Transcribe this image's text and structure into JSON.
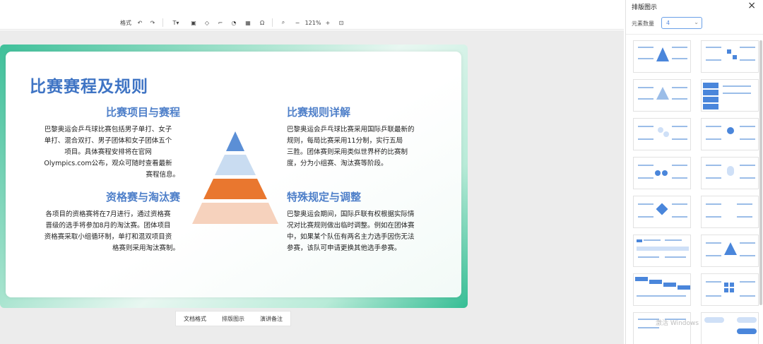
{
  "toolbar": {
    "format_label": "格式",
    "zoom_value": "121%"
  },
  "slide": {
    "title": "比赛赛程及规则",
    "sections": {
      "schedule": {
        "heading": "比赛项目与赛程",
        "lines": [
          "巴黎奥运会乒乓球比赛包括男子单打、女子",
          "单打、混合双打、男子团体和女子团体五个",
          "项目。具体赛程安排将在官网",
          "Olympics.com公布，观众可随时查看最新",
          "赛程信息。"
        ]
      },
      "rules": {
        "heading": "比赛规则详解",
        "lines": [
          "巴黎奥运会乒乓球比赛采用国际乒联最新的",
          "规则，每局比赛采用11分制，实行五局",
          "三胜。团体赛则采用类似世界杯的比赛制",
          "度，分为小组赛、淘汰赛等阶段。"
        ]
      },
      "qualify": {
        "heading": "资格赛与淘汰赛",
        "lines": [
          "各项目的资格赛将在7月进行，通过资格赛",
          "晋级的选手将参加8月的淘汰赛。团体项目",
          "资格赛采取小组循环制，单打和混双项目资",
          "格赛则采用淘汰赛制。"
        ]
      },
      "special": {
        "heading": "特殊规定与调整",
        "lines": [
          "巴黎奥运会期间，国际乒联有权根据实际情",
          "况对比赛规则做出临时调整。例如在团体赛",
          "中，如果某个队伍有两名主力选手因伤无法",
          "参赛，该队可申请更换其他选手参赛。"
        ]
      }
    }
  },
  "bottom_strip": {
    "items": [
      "文档格式",
      "排版图示",
      "演讲备注"
    ]
  },
  "panel": {
    "title": "排版图示",
    "count_label": "元素数量",
    "count_value": "4"
  },
  "watermark": "激活 Windows",
  "colors": {
    "title_blue": "#3f74c4",
    "heading_blue": "#4e7fc9",
    "pyramid": [
      "#5b8fd6",
      "#c9dcf1",
      "#e9772f",
      "#f6d2bd"
    ],
    "frame_green": "#3fc09a"
  }
}
